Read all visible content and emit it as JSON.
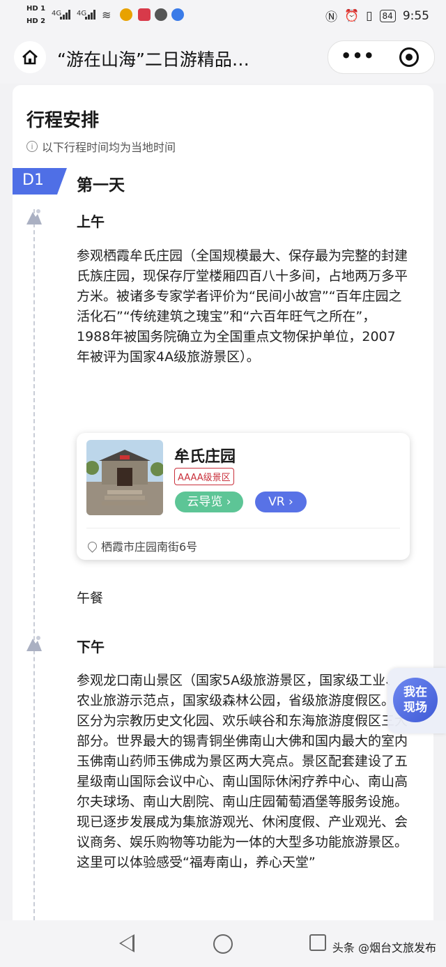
{
  "status_bar": {
    "hd1": "HD 1",
    "hd2": "HD 2",
    "signal1": "4G",
    "signal2": "4G",
    "battery": "84",
    "time": "9:55"
  },
  "nav": {
    "title": "“游在山海”二日游精品…",
    "more": "•••"
  },
  "section": {
    "title": "行程安排",
    "note": "以下行程时间均为当地时间"
  },
  "day": {
    "badge": "D1",
    "title": "第一天"
  },
  "morning": {
    "label": "上午",
    "desc": "参观栖霞牟氏庄园（全国规模最大、保存最为完整的封建氏族庄园，现保存厅堂楼厢四百八十多间，占地两万多平方米。被诸多专家学者评价为“民间小故宫”“百年庄园之活化石”“传统建筑之瑰宝”和“六百年旺气之所在”，1988年被国务院确立为全国重点文物保护单位，2007年被评为国家4A级旅游景区）。"
  },
  "poi": {
    "name": "牟氏庄园",
    "tag": "AAAA级景区",
    "cloud_label": "云导览 ›",
    "vr_label": "VR ›",
    "address": "栖霞市庄园南街6号",
    "colors": {
      "cloud": "#5dc596",
      "vr": "#5872e6",
      "tag": "#c9303b"
    }
  },
  "lunch": "午餐",
  "afternoon": {
    "label": "下午",
    "desc": "参观龙口南山景区（国家5A级旅游景区，国家级工业、农业旅游示范点，国家级森林公园，省级旅游度假区。景区分为宗教历史文化园、欢乐峡谷和东海旅游度假区三大部分。世界最大的锡青铜坐佛南山大佛和国内最大的室内玉佛南山药师玉佛成为景区两大亮点。景区配套建设了五星级南山国际会议中心、南山国际休闲疗养中心、南山高尔夫球场、南山大剧院、南山庄园葡萄酒堡等服务设施。现已逐步发展成为集旅游观光、休闲度假、产业观光、会议商务、娱乐购物等功能为一体的大型多功能旅游景区。这里可以体验感受“福寿南山，养心天堂”"
  },
  "floating": {
    "label_line1": "我在",
    "label_line2": "现场"
  },
  "bottom": {
    "watermark": "头条 @烟台文旅发布"
  },
  "accent_color": "#4f6fe6"
}
